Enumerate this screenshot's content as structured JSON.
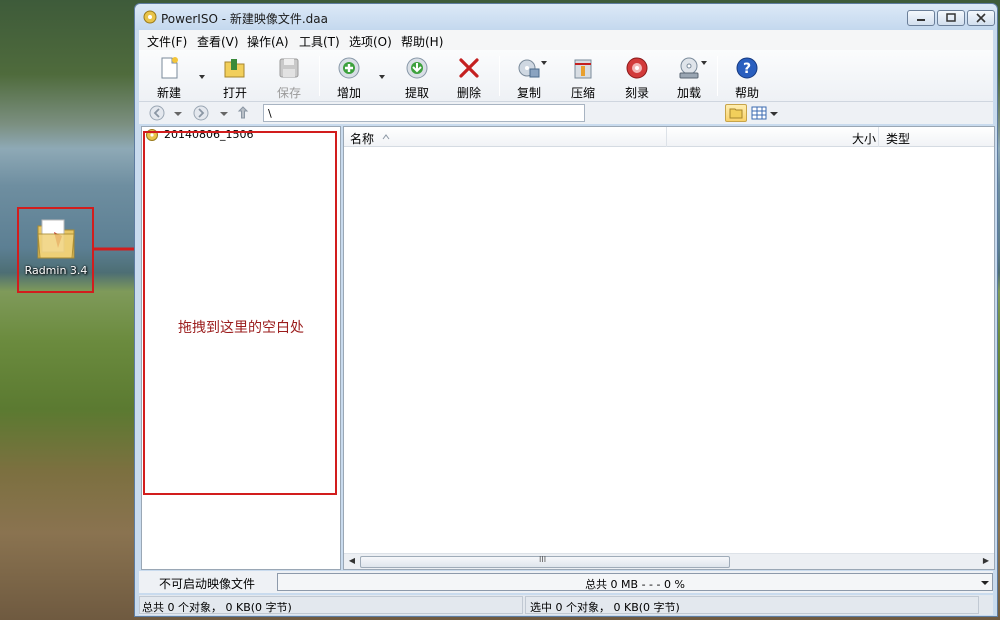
{
  "desktop": {
    "icon_label": "Radmin 3.4"
  },
  "window": {
    "title": "PowerISO - 新建映像文件.daa"
  },
  "menu": [
    {
      "label": "文件(F)"
    },
    {
      "label": "查看(V)"
    },
    {
      "label": "操作(A)"
    },
    {
      "label": "工具(T)"
    },
    {
      "label": "选项(O)"
    },
    {
      "label": "帮助(H)"
    }
  ],
  "toolbar": {
    "new": "新建",
    "open": "打开",
    "save": "保存",
    "add": "增加",
    "extract": "提取",
    "delete": "删除",
    "copy": "复制",
    "compress": "压缩",
    "burn": "刻录",
    "mount": "加载",
    "help": "帮助"
  },
  "address": {
    "path": "\\"
  },
  "tree": {
    "root": "20140806_1506"
  },
  "list": {
    "columns": {
      "name": "名称",
      "size": "大小",
      "type": "类型"
    },
    "scroll_grip": "III"
  },
  "annotation": {
    "instruction": "拖拽到这里的空白处"
  },
  "bottom": {
    "boot_label": "不可启动映像文件",
    "capacity": "总共  0 MB   - - -  0 %"
  },
  "status": {
    "left": "总共 0 个对象， 0 KB(0 字节)",
    "right": "选中 0 个对象， 0 KB(0 字节)"
  },
  "colors": {
    "highlight": "#d21d1d",
    "instruction_text": "#9b1c1c"
  }
}
